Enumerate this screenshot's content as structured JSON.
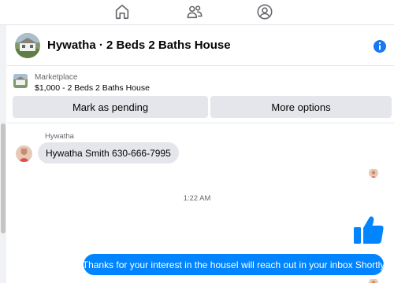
{
  "nav": {
    "items": [
      {
        "icon": "home-icon"
      },
      {
        "icon": "people-icon"
      },
      {
        "icon": "profile-circle-icon"
      }
    ]
  },
  "header": {
    "title": "Hywatha · 2 Beds 2 Baths House",
    "info_icon": "info-icon"
  },
  "marketplace": {
    "source": "Marketplace",
    "listing": "$1,000 - 2 Beds 2 Baths House",
    "pending_label": "Mark as pending",
    "more_label": "More options"
  },
  "conversation": {
    "sender_name": "Hywatha",
    "incoming_message": "Hywatha Smith 630-666-7995",
    "timestamp": "1:22 AM",
    "reaction": "thumbs-up-icon",
    "outgoing_message": "Thanks for your interest in the houseI will reach out in your inbox Shortly"
  },
  "colors": {
    "accent": "#0084ff",
    "bubble_in": "#e4e6eb",
    "info": "#1877f2"
  }
}
